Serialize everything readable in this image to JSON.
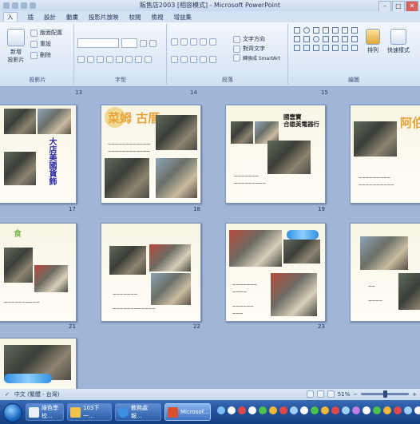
{
  "window": {
    "title": "販售店2003 [相容模式] - Microsoft PowerPoint",
    "minimize": "–",
    "maximize": "□",
    "close": "✕"
  },
  "tabs": [
    "入",
    "插",
    "設計",
    "動畫",
    "投影片放映",
    "校閱",
    "檢視",
    "增益集"
  ],
  "ribbon": {
    "clipboard": {
      "new_slide": "新增\n投影片",
      "layout": "版面配置",
      "reset": "重設",
      "delete": "刪除",
      "label": "投影片"
    },
    "font": {
      "label": "字型"
    },
    "paragraph": {
      "text_direction": "文字方向",
      "align_text": "對齊文字",
      "smartart": "轉換成 SmartArt",
      "label": "段落"
    },
    "drawing": {
      "arrange": "排列",
      "quick_styles": "快速樣式",
      "label": "繪圖"
    }
  },
  "slide_numbers_top": [
    "13",
    "14",
    "15"
  ],
  "slides": [
    {
      "num": "17",
      "heading": "",
      "sub": "",
      "vtext": "大店美國貨飾"
    },
    {
      "num": "18",
      "heading": "菜姆 古厝",
      "sub": "",
      "vtext": ""
    },
    {
      "num": "19",
      "heading": "",
      "sub": "",
      "vtext": "國雲寶\n合雄美電器行"
    },
    {
      "num": "",
      "heading": "阿伯",
      "sub": "",
      "vtext": ""
    },
    {
      "num": "21",
      "heading": "食",
      "sub": "",
      "vtext": ""
    },
    {
      "num": "22",
      "heading": "",
      "sub": "",
      "vtext": ""
    },
    {
      "num": "23",
      "heading": "",
      "sub": "",
      "vtext": ""
    },
    {
      "num": "",
      "heading": "",
      "sub": "",
      "vtext": ""
    },
    {
      "num": "",
      "heading": "",
      "sub": "",
      "vtext": ""
    }
  ],
  "statusbar": {
    "language": "中文 (繁體 - 台灣)",
    "zoom": "51%"
  },
  "taskbar": {
    "buttons": [
      "綠色學校...",
      "103下一...",
      "教務處報...",
      "Microsof..."
    ]
  }
}
